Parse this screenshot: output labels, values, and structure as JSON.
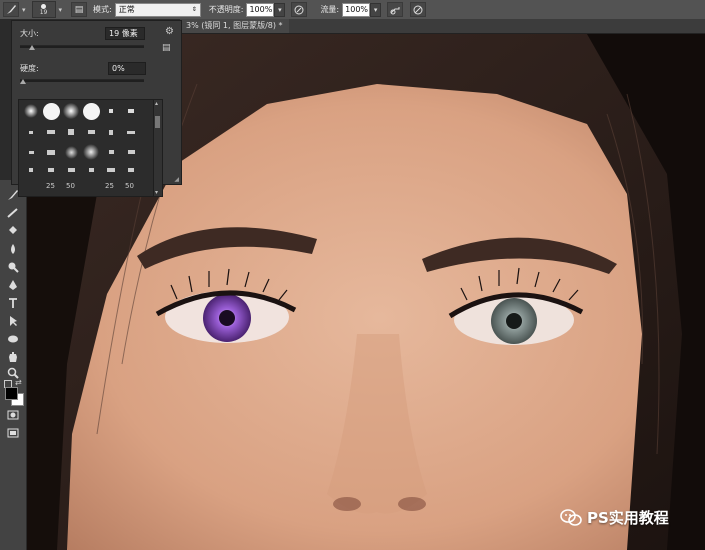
{
  "options_bar": {
    "brush_size": "19",
    "mode_label": "模式:",
    "mode_value": "正常",
    "opacity_label": "不透明度:",
    "opacity_value": "100%",
    "flow_label": "流量:",
    "flow_value": "100%"
  },
  "document_tab": {
    "title": "3% (镜同 1, 图层蒙版/8) *"
  },
  "brush_panel": {
    "size_label": "大小:",
    "size_value": "19 像素",
    "size_slider_fraction": 0.1,
    "hardness_label": "硬度:",
    "hardness_value": "0%",
    "hardness_slider_fraction": 0.0,
    "preset_numbers": [
      "25",
      "50",
      "25",
      "50"
    ]
  },
  "watermark": {
    "text": "PS实用教程"
  },
  "colors": {
    "foreground": "#000000",
    "background": "#ffffff",
    "ui_dark": "#3a3a3a"
  }
}
